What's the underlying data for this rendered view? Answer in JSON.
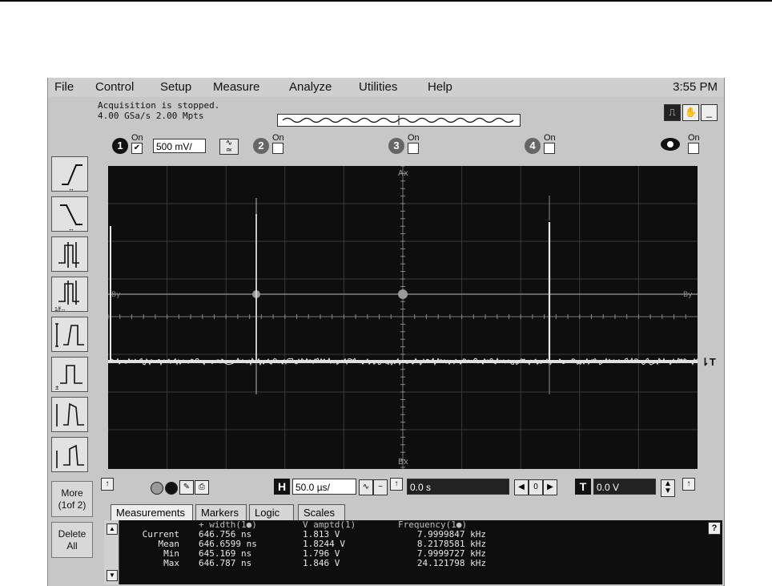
{
  "menu": [
    "File",
    "Control",
    "Setup",
    "Measure",
    "Analyze",
    "Utilities",
    "Help"
  ],
  "clock": "3:55 PM",
  "status": {
    "line1": "Acquisition is stopped.",
    "line2": "4.00 GSa/s  2.00 Mpts"
  },
  "channels": [
    {
      "num": "1",
      "on_label": "On",
      "checked": true,
      "scale": "500 mV/"
    },
    {
      "num": "2",
      "on_label": "On",
      "checked": false
    },
    {
      "num": "3",
      "on_label": "On",
      "checked": false
    },
    {
      "num": "4",
      "on_label": "On",
      "checked": false
    },
    {
      "num": "",
      "on_label": "On",
      "checked": false
    }
  ],
  "sidebar": {
    "more_label": "More",
    "more_sub": "(1of 2)",
    "delete_label": "Delete",
    "delete_sub": "All"
  },
  "screen_markers": {
    "ax": "Ax",
    "bx": "Bx",
    "by_left": "By",
    "by_right": "By",
    "trig": "T"
  },
  "horizontal": {
    "h_label": "H",
    "scale": "50.0 µs/",
    "position": "0.0 s",
    "center_btn": "0"
  },
  "trigger": {
    "t_label": "T",
    "level": "0.0 V"
  },
  "tabs": [
    "Measurements",
    "Markers",
    "Logic",
    "Scales"
  ],
  "measurements": {
    "headers": [
      "+ width(1●)",
      "V amptd(1)",
      "Frequency(1●)"
    ],
    "rows": [
      {
        "label": "Current",
        "values": [
          "646.756 ns",
          "1.813 V",
          "7.9999847 kHz"
        ]
      },
      {
        "label": "Mean",
        "values": [
          "646.6599 ns",
          "1.8244 V",
          "8.2178581 kHz"
        ]
      },
      {
        "label": "Min",
        "values": [
          "645.169 ns",
          "1.796 V",
          "7.9999727 kHz"
        ]
      },
      {
        "label": "Max",
        "values": [
          "646.787 ns",
          "1.846 V",
          "24.121798 kHz"
        ]
      }
    ],
    "help": "?"
  }
}
